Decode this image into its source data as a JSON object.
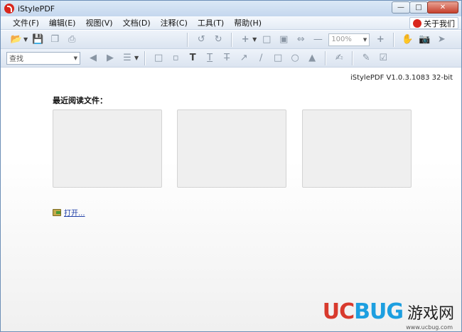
{
  "window": {
    "title": "iStylePDF"
  },
  "menu": {
    "items": [
      "文件(F)",
      "编辑(E)",
      "视图(V)",
      "文档(D)",
      "注释(C)",
      "工具(T)",
      "帮助(H)"
    ],
    "about_label": "关于我们"
  },
  "toolbar": {
    "zoom_value": "100%",
    "search_label": "查找"
  },
  "content": {
    "version": "iStylePDF V1.0.3.1083 32-bit",
    "recent_title": "最近阅读文件：",
    "open_label": "打开..."
  },
  "watermark": {
    "uc": "UC",
    "bug": "BUG",
    "cn": "游戏网",
    "url": "www.ucbug.com"
  }
}
